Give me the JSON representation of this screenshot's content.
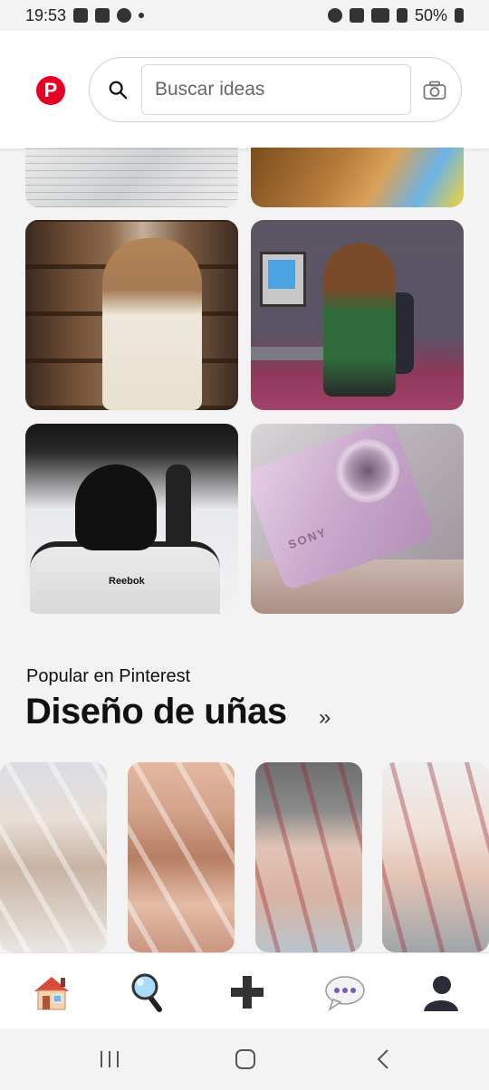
{
  "status_bar": {
    "time": "19:53",
    "battery": "50%"
  },
  "header": {
    "logo_letter": "P",
    "search": {
      "placeholder": "Buscar ideas",
      "value": ""
    },
    "brand_color": "#E60023"
  },
  "pins": [
    {
      "name": "study-notes"
    },
    {
      "name": "colorful-house"
    },
    {
      "name": "bookshelf-reader"
    },
    {
      "name": "cartoon-computer"
    },
    {
      "name": "hockey-player"
    },
    {
      "name": "sony-camera"
    }
  ],
  "pin_text": {
    "reebok": "Reebok",
    "sony": "SONY"
  },
  "section": {
    "subtitle": "Popular en Pinterest",
    "title": "Diseño de uñas",
    "chevron": "»"
  },
  "nails": [
    {
      "name": "nail-white-french"
    },
    {
      "name": "nail-gold-stars"
    },
    {
      "name": "nail-red-tips"
    },
    {
      "name": "nail-burgundy-hearts"
    }
  ],
  "bottom_nav": [
    {
      "icon": "home-icon"
    },
    {
      "icon": "search-icon"
    },
    {
      "icon": "plus-icon"
    },
    {
      "icon": "chat-icon"
    },
    {
      "icon": "profile-icon"
    }
  ],
  "android_nav": [
    "recent-apps",
    "home",
    "back"
  ]
}
